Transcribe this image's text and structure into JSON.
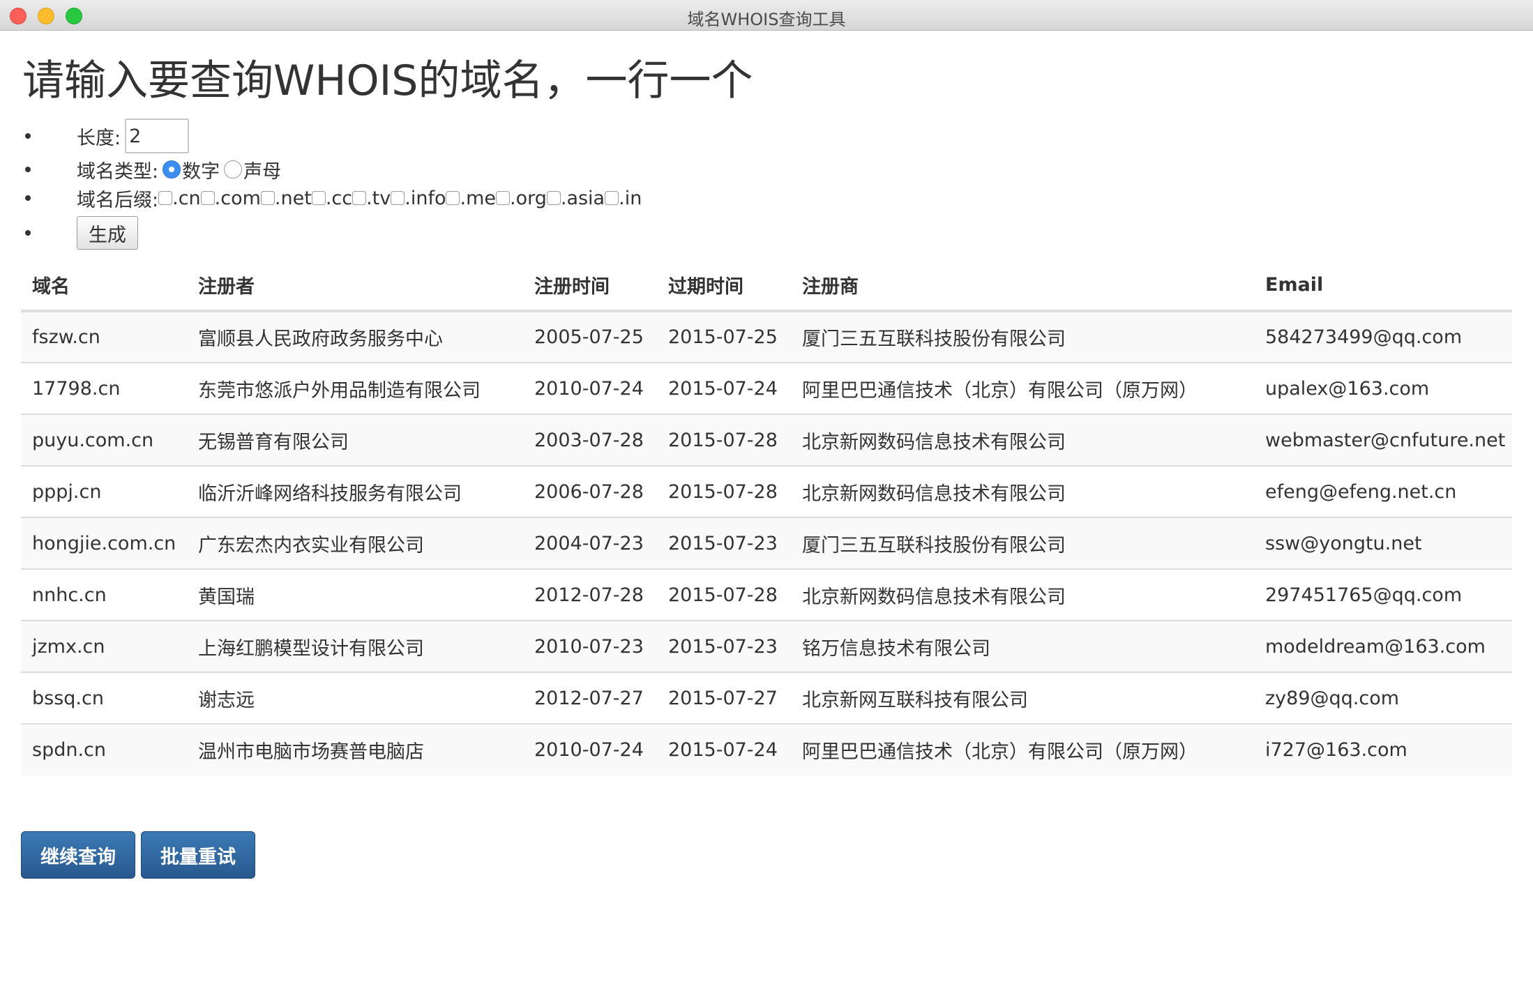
{
  "window": {
    "title": "域名WHOIS查询工具"
  },
  "heading": "请输入要查询WHOIS的域名，一行一个",
  "options": {
    "length_label": "长度:",
    "length_value": "2",
    "type_label": "域名类型:",
    "type_options": [
      {
        "label": "数字",
        "checked": true
      },
      {
        "label": "声母",
        "checked": false
      }
    ],
    "suffix_label": "域名后缀:",
    "suffixes": [
      ".cn",
      ".com",
      ".net",
      ".cc",
      ".tv",
      ".info",
      ".me",
      ".org",
      ".asia",
      ".in"
    ],
    "generate_label": "生成"
  },
  "table": {
    "headers": [
      "域名",
      "注册者",
      "注册时间",
      "过期时间",
      "注册商",
      "Email"
    ],
    "rows": [
      [
        "fszw.cn",
        "富顺县人民政府政务服务中心",
        "2005-07-25",
        "2015-07-25",
        "厦门三五互联科技股份有限公司",
        "584273499@qq.com"
      ],
      [
        "17798.cn",
        "东莞市悠派户外用品制造有限公司",
        "2010-07-24",
        "2015-07-24",
        "阿里巴巴通信技术（北京）有限公司（原万网）",
        "upalex@163.com"
      ],
      [
        "puyu.com.cn",
        "无锡普育有限公司",
        "2003-07-28",
        "2015-07-28",
        "北京新网数码信息技术有限公司",
        "webmaster@cnfuture.net"
      ],
      [
        "pppj.cn",
        "临沂沂峰网络科技服务有限公司",
        "2006-07-28",
        "2015-07-28",
        "北京新网数码信息技术有限公司",
        "efeng@efeng.net.cn"
      ],
      [
        "hongjie.com.cn",
        "广东宏杰内衣实业有限公司",
        "2004-07-23",
        "2015-07-23",
        "厦门三五互联科技股份有限公司",
        "ssw@yongtu.net"
      ],
      [
        "nnhc.cn",
        "黄国瑞",
        "2012-07-28",
        "2015-07-28",
        "北京新网数码信息技术有限公司",
        "297451765@qq.com"
      ],
      [
        "jzmx.cn",
        "上海红鹏模型设计有限公司",
        "2010-07-23",
        "2015-07-23",
        "铭万信息技术有限公司",
        "modeldream@163.com"
      ],
      [
        "bssq.cn",
        "谢志远",
        "2012-07-27",
        "2015-07-27",
        "北京新网互联科技有限公司",
        "zy89@qq.com"
      ],
      [
        "spdn.cn",
        "温州市电脑市场赛普电脑店",
        "2010-07-24",
        "2015-07-24",
        "阿里巴巴通信技术（北京）有限公司（原万网）",
        "i727@163.com"
      ]
    ]
  },
  "buttons": {
    "continue": "继续查询",
    "retry": "批量重试"
  },
  "colors": {
    "primary_button": "#2f6aa3",
    "radio_checked": "#3b8ef0",
    "stripe": "#f9f9f9"
  }
}
